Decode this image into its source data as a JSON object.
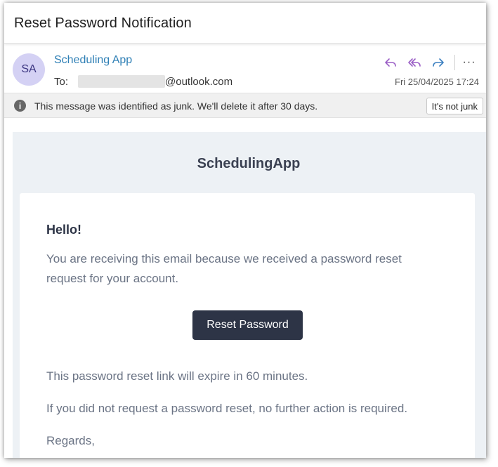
{
  "subject": "Reset Password Notification",
  "message": {
    "avatar_initials": "SA",
    "sender": "Scheduling App",
    "to_label": "To:",
    "to_domain": "@outlook.com",
    "date": "Fri 25/04/2025 17:24",
    "more_label": "···"
  },
  "junk_bar": {
    "info_glyph": "i",
    "text": "This message was identified as junk. We'll delete it after 30 days.",
    "button_label": "It's not junk"
  },
  "email_body": {
    "brand": "SchedulingApp",
    "greeting": "Hello!",
    "intro": "You are receiving this email because we received a password reset request for your account.",
    "button_label": "Reset Password",
    "expiry": "This password reset link will expire in 60 minutes.",
    "no_action": "If you did not request a password reset, no further action is required.",
    "regards": "Regards,"
  },
  "colors": {
    "accent_purple": "#9b5fc6",
    "forward_blue": "#3a7fc0",
    "sender_blue": "#2e7fb5",
    "button_dark": "#2d3446"
  },
  "icons": [
    "reply-icon",
    "reply-all-icon",
    "forward-icon",
    "more-options-icon",
    "info-icon"
  ]
}
